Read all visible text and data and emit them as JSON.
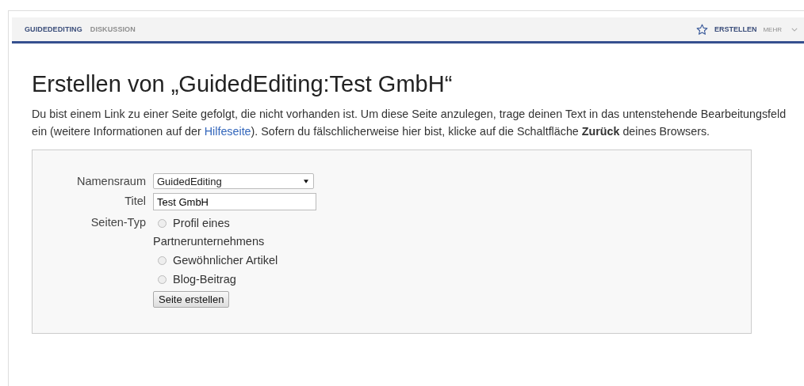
{
  "tabs": [
    {
      "label": "GUIDEDEDITING",
      "selected": true
    },
    {
      "label": "DISKUSSION",
      "selected": false
    }
  ],
  "actions": {
    "watch": {
      "starred": false
    },
    "create": "ERSTELLEN",
    "more": "MEHR"
  },
  "heading": "Erstellen von „GuidedEditing:Test GmbH“",
  "intro": {
    "before": "Du bist einem Link zu einer Seite gefolgt, die nicht vorhanden ist. Um diese Seite anzulegen, trage deinen Text in das untenstehende Bearbeitungsfeld ein (weitere Informationen auf der ",
    "link": "Hilfeseite",
    "after": "). Sofern du fälschlicherweise hier bist, klicke auf die Schaltfläche **Zurück** deines Browsers."
  },
  "form": {
    "namespace": {
      "label": "Namensraum",
      "value": "GuidedEditing"
    },
    "title": {
      "label": "Titel",
      "value": "Test GmbH"
    },
    "page_type": {
      "label": "Seiten-Typ",
      "options": [
        {
          "label": "Profil eines Partnerunternehmens",
          "selected": false
        },
        {
          "label": "Gewöhnlicher Artikel",
          "selected": false
        },
        {
          "label": "Blog-Beitrag",
          "selected": false
        }
      ]
    },
    "submit": "Seite erstellen"
  }
}
